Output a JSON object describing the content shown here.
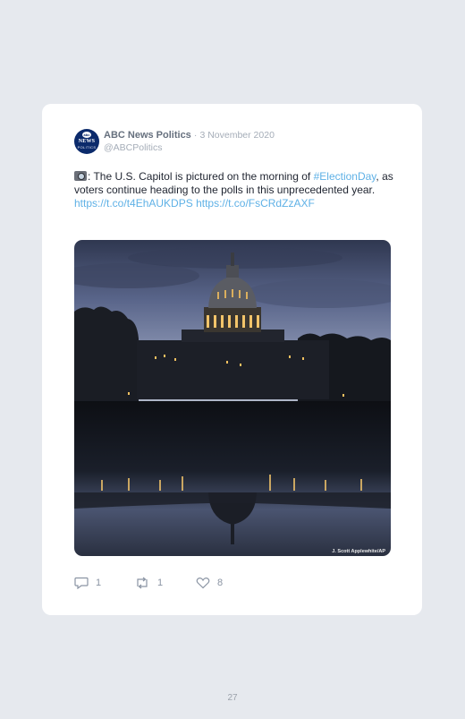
{
  "tweet": {
    "author_name": "ABC News Politics",
    "separator": "·",
    "date": "3 November 2020",
    "handle": "@ABCPolitics",
    "avatar_logo": {
      "top": "abc",
      "middle": "NEWS",
      "bottom": "POLITICS"
    },
    "emoji_icon": "camera-icon",
    "text_1": ": The U.S. Capitol is pictured on the morning of",
    "hashtag": "#ElectionDay",
    "text_2": ", as voters continue heading to the polls in this unprecedented year.",
    "link_1": "https://t.co/t4EhAUKDPS",
    "link_2": "https://t.co/FsCRdZzAXF",
    "photo_credit": "J. Scott Applewhite/AP",
    "replies": "1",
    "retweets": "1",
    "likes": "8"
  },
  "page": {
    "number": "27"
  },
  "colors": {
    "background": "#e6e9ee",
    "card": "#ffffff",
    "link": "#5fb1e6",
    "muted": "#a5adb8"
  }
}
